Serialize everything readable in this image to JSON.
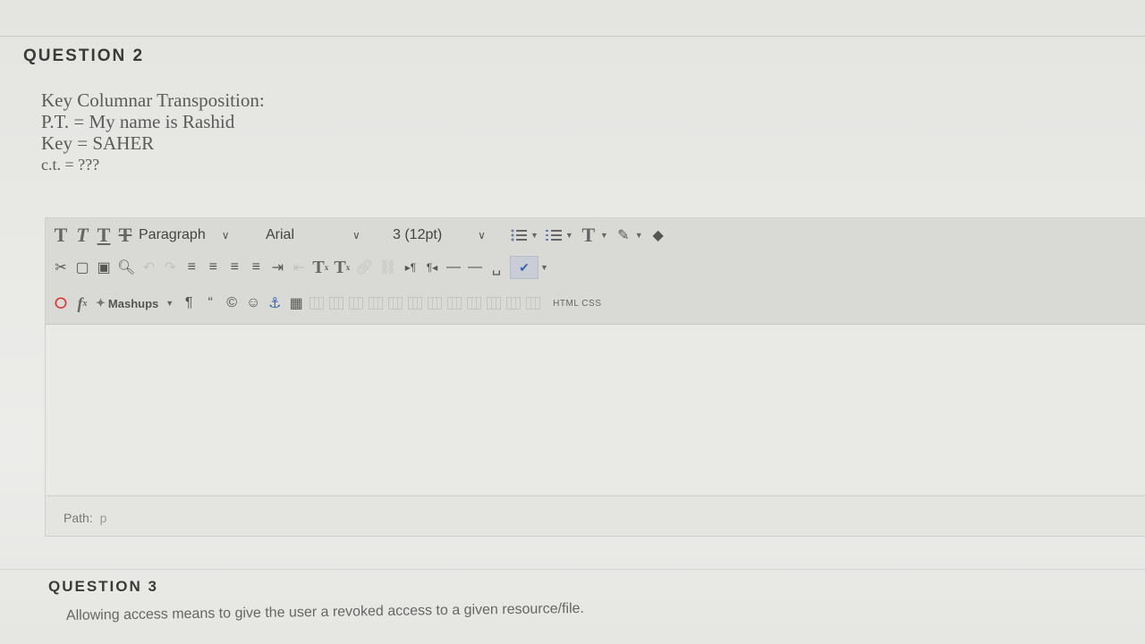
{
  "question2": {
    "heading": "QUESTION 2",
    "lines": [
      "Key Columnar Transposition:",
      "P.T. = My name is Rashid",
      "Key = SAHER",
      "c.t. = ???"
    ]
  },
  "editor": {
    "toolbar": {
      "row1": {
        "text_style_buttons": [
          "T",
          "T",
          "T",
          "T"
        ],
        "paragraph_select": "Paragraph",
        "font_select": "Arial",
        "size_select": "3 (12pt)",
        "text_color_button": "T"
      },
      "row2": {
        "superscript": "T",
        "subscript": "T"
      },
      "row3": {
        "mashups": "Mashups",
        "html_css": "HTML CSS"
      }
    },
    "path": {
      "label": "Path:",
      "value": "p"
    }
  },
  "question3": {
    "heading": "QUESTION 3",
    "text": "Allowing access means to give the user a revoked  access to a given resource/file."
  },
  "colors": {
    "accent_blue": "#3a66aa",
    "stop_red": "#d33333"
  }
}
